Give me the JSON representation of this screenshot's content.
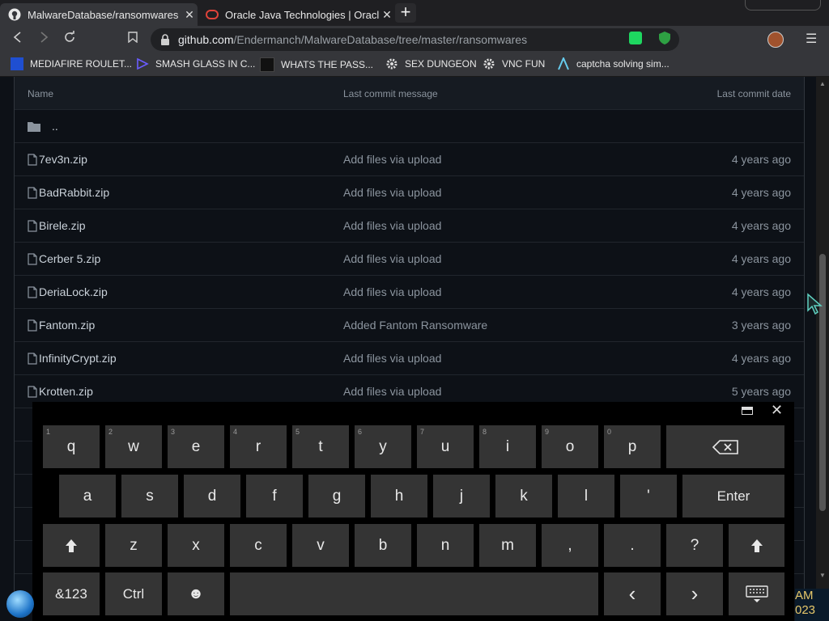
{
  "tabs": [
    {
      "title": "MalwareDatabase/ransomwares at",
      "icon": "github-icon"
    },
    {
      "title": "Oracle Java Technologies | Oracle",
      "icon": "oracle-icon"
    }
  ],
  "new_tab": "+",
  "url": {
    "host": "github.com",
    "path": "/Endermanch/MalwareDatabase/tree/master/ransomwares"
  },
  "bookmarks": [
    {
      "label": "MEDIAFIRE ROULET..."
    },
    {
      "label": "SMASH GLASS IN C..."
    },
    {
      "label": "WHATS THE PASS..."
    },
    {
      "label": "SEX DUNGEON"
    },
    {
      "label": "VNC FUN"
    },
    {
      "label": "captcha solving sim..."
    }
  ],
  "table": {
    "headers": {
      "name": "Name",
      "message": "Last commit message",
      "date": "Last commit date"
    },
    "parent": "..",
    "rows": [
      {
        "name": "7ev3n.zip",
        "message": "Add files via upload",
        "date": "4 years ago"
      },
      {
        "name": "BadRabbit.zip",
        "message": "Add files via upload",
        "date": "4 years ago"
      },
      {
        "name": "Birele.zip",
        "message": "Add files via upload",
        "date": "4 years ago"
      },
      {
        "name": "Cerber 5.zip",
        "message": "Add files via upload",
        "date": "4 years ago"
      },
      {
        "name": "DeriaLock.zip",
        "message": "Add files via upload",
        "date": "4 years ago"
      },
      {
        "name": "Fantom.zip",
        "message": "Added Fantom Ransomware",
        "date": "3 years ago"
      },
      {
        "name": "InfinityCrypt.zip",
        "message": "Add files via upload",
        "date": "4 years ago"
      },
      {
        "name": "Krotten.zip",
        "message": "Add files via upload",
        "date": "5 years ago"
      }
    ]
  },
  "keyboard": {
    "row1": [
      {
        "label": "q",
        "hint": "1"
      },
      {
        "label": "w",
        "hint": "2"
      },
      {
        "label": "e",
        "hint": "3"
      },
      {
        "label": "r",
        "hint": "4"
      },
      {
        "label": "t",
        "hint": "5"
      },
      {
        "label": "y",
        "hint": "6"
      },
      {
        "label": "u",
        "hint": "7"
      },
      {
        "label": "i",
        "hint": "8"
      },
      {
        "label": "o",
        "hint": "9"
      },
      {
        "label": "p",
        "hint": "0"
      }
    ],
    "backspace": "⌫",
    "row2": [
      "a",
      "s",
      "d",
      "f",
      "g",
      "h",
      "j",
      "k",
      "l",
      "'"
    ],
    "enter": "Enter",
    "shift": "🡅",
    "row3": [
      "z",
      "x",
      "c",
      "v",
      "b",
      "n",
      "m",
      ",",
      ".",
      "?"
    ],
    "symbols": "&123",
    "ctrl": "Ctrl",
    "emoji": "☻",
    "left": "‹",
    "right": "›",
    "close": "✕"
  },
  "clock": {
    "line1": "AM",
    "line2": "023"
  }
}
